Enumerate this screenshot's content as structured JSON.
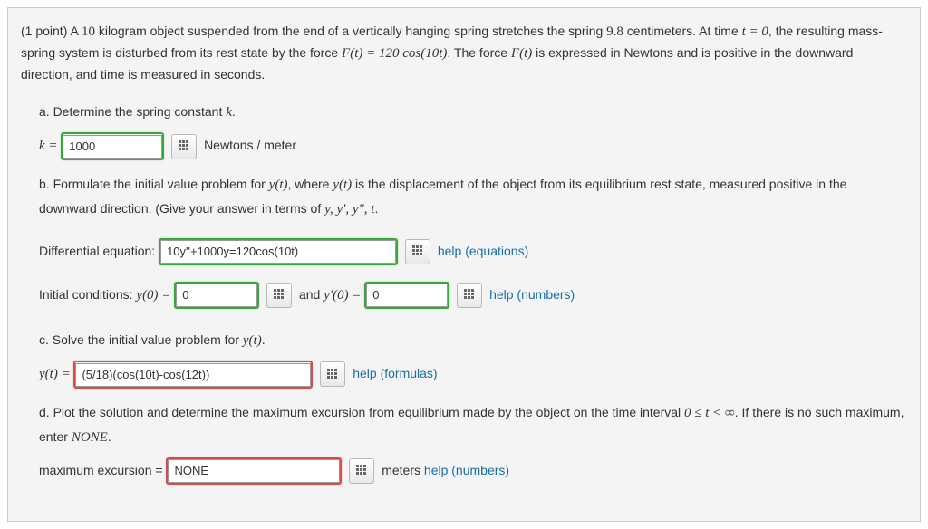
{
  "points": "(1 point)",
  "intro_parts": {
    "p1a": "A ",
    "mass": "10",
    "p1b": " kilogram object suspended from the end of a vertically hanging spring stretches the spring ",
    "stretch": "9.8",
    "p1c": " centimeters. At time ",
    "t0": "t = 0",
    "p1d": ", the resulting mass-spring system is disturbed from its rest state by the force ",
    "force": "F(t) = 120 cos(10t)",
    "p1e": ". The force ",
    "ft": "F(t)",
    "p1f": " is expressed in Newtons and is positive in the downward direction, and time is measured in seconds."
  },
  "part_a": {
    "prompt": "a. Determine the spring constant ",
    "kvar": "k",
    "keq": "k = ",
    "value": "1000",
    "units": "Newtons / meter"
  },
  "part_b": {
    "prompt1": "b. Formulate the initial value problem for ",
    "yt": "y(t)",
    "prompt2": ", where ",
    "prompt3": " is the displacement of the object from its equilibrium rest state, measured positive in the downward direction. (Give your answer in terms of ",
    "vars": "y, y′, y″, t",
    "de_label": "Differential equation:",
    "de_value": "10y''+1000y=120cos(10t)",
    "help_eq": "help (equations)",
    "ic_label": "Initial conditions: ",
    "y0": "y(0) = ",
    "y0_value": "0",
    "and": "and ",
    "yp0": "y′(0) = ",
    "yp0_value": "0",
    "help_num": "help (numbers)"
  },
  "part_c": {
    "prompt": "c. Solve the initial value problem for ",
    "yt": "y(t)",
    "yteq": "y(t) = ",
    "value": "(5/18)(cos(10t)-cos(12t))",
    "help": "help (formulas)"
  },
  "part_d": {
    "prompt": "d. Plot the solution and determine the maximum excursion from equilibrium made by the object on the time interval ",
    "range": "0 ≤ t < ∞",
    "prompt2": ". If there is no such maximum, enter ",
    "none": "NONE",
    "label": "maximum excursion = ",
    "value": "NONE",
    "units": "meters ",
    "help": "help (numbers)"
  }
}
